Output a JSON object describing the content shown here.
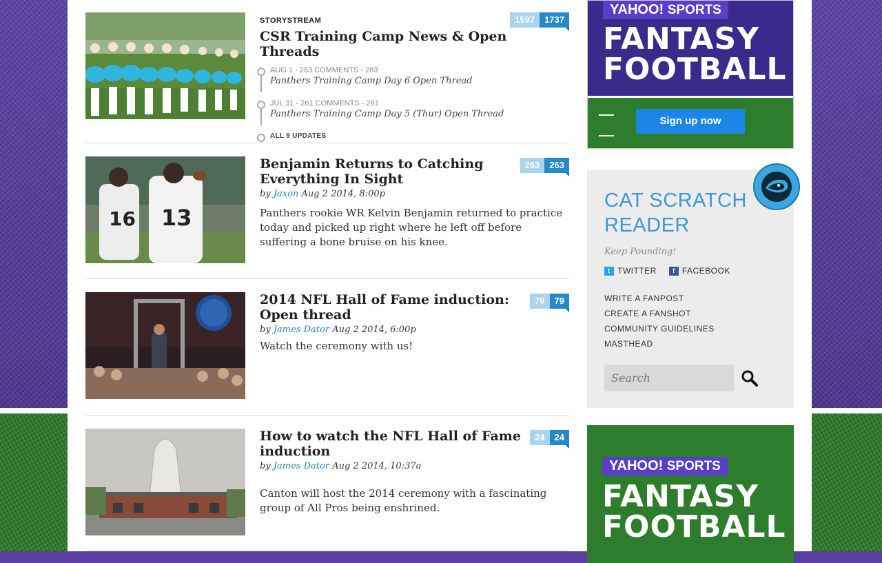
{
  "entries": [
    {
      "kicker": "STORYSTREAM",
      "title": "CSR Training Camp News & Open Threads",
      "count_a": "1597",
      "count_b": "1737",
      "updates": [
        {
          "date": "AUG 1",
          "comments": "283 COMMENTS",
          "num": "283",
          "title": "Panthers Training Camp Day 6 Open Thread"
        },
        {
          "date": "JUL 31",
          "comments": "261 COMMENTS",
          "num": "261",
          "title": "Panthers Training Camp Day 5 (Thur) Open Thread"
        }
      ],
      "all_updates": "ALL 9 UPDATES"
    },
    {
      "title": "Benjamin Returns to Catching Everything In Sight",
      "by": "by",
      "author": "Jaxon",
      "date": "Aug 2 2014, 8:00p",
      "dek": "Panthers rookie WR Kelvin Benjamin returned to practice today and picked up right where he left off before suffering a bone bruise on his knee.",
      "count_a": "263",
      "count_b": "263"
    },
    {
      "title": "2014 NFL Hall of Fame induction: Open thread",
      "by": "by",
      "author": "James Dator",
      "date": "Aug 2 2014, 6:00p",
      "dek": "Watch the ceremony with us!",
      "count_a": "79",
      "count_b": "79"
    },
    {
      "title": "How to watch the NFL Hall of Fame induction",
      "by": "by",
      "author": "James Dator",
      "date": "Aug 2 2014, 10:37a",
      "dek": "Canton will host the 2014 ceremony with a fascinating group of All Pros being enshrined.",
      "count_a": "24",
      "count_b": "24"
    }
  ],
  "ad": {
    "yahoo": "YAHOO!",
    "sports": "SPORTS",
    "line1": "FANTASY",
    "line2": "FOOTBALL",
    "signup": "Sign up now"
  },
  "reader": {
    "title_line1": "CAT SCRATCH",
    "title_line2": "READER",
    "tagline": "Keep Pounding!",
    "twitter": "TWITTER",
    "facebook": "FACEBOOK",
    "links": [
      "WRITE A FANPOST",
      "CREATE A FANSHOT",
      "COMMUNITY GUIDELINES",
      "MASTHEAD"
    ],
    "search_placeholder": "Search"
  }
}
